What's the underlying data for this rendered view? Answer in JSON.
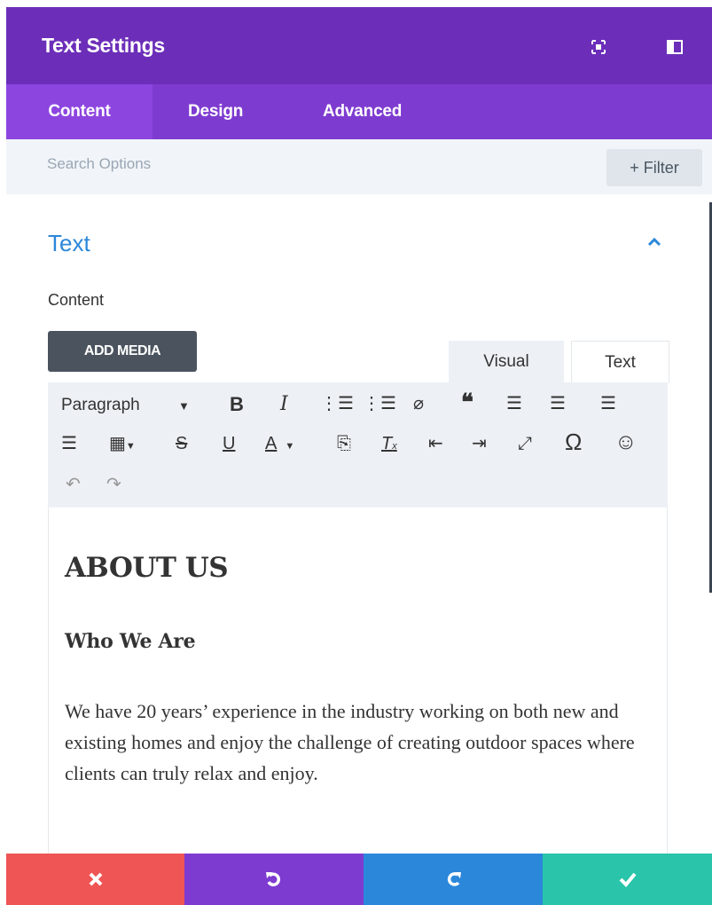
{
  "header": {
    "title": "Text Settings",
    "icons": [
      "expand-icon",
      "split-view-icon"
    ],
    "color": "#6c2eb9"
  },
  "tabs": [
    {
      "label": "Content",
      "active": true
    },
    {
      "label": "Design",
      "active": false
    },
    {
      "label": "Advanced",
      "active": false
    }
  ],
  "search": {
    "placeholder": "Search Options",
    "filter_label": "+ Filter"
  },
  "section": {
    "title": "Text",
    "field_label": "Content",
    "accent": "#2b87da"
  },
  "editor": {
    "add_media": "ADD MEDIA",
    "tab_visual": "Visual",
    "tab_text": "Text",
    "format_select": "Paragraph",
    "toolbar_icons": [
      "bold-icon",
      "italic-icon",
      "bullet-list-icon",
      "numbered-list-icon",
      "link-icon",
      "blockquote-icon",
      "align-left-icon",
      "align-center-icon",
      "align-right-icon",
      "justify-icon",
      "table-icon",
      "strikethrough-icon",
      "underline-icon",
      "text-color-icon",
      "paste-text-icon",
      "clear-formatting-icon",
      "outdent-icon",
      "indent-icon",
      "fullscreen-icon",
      "special-character-icon",
      "emoji-icon",
      "undo-icon",
      "redo-icon"
    ],
    "body": {
      "heading": "ABOUT US",
      "subheading": "Who We Are",
      "paragraph": "We have 20 years’ experience in the industry working on both new and existing homes and enjoy the challenge of creating outdoor spaces where clients can truly relax and enjoy."
    }
  },
  "footer": {
    "buttons": [
      {
        "icon": "close-icon",
        "color": "#ef5555"
      },
      {
        "icon": "undo-icon",
        "color": "#7e3bd0"
      },
      {
        "icon": "redo-icon",
        "color": "#2b87da"
      },
      {
        "icon": "check-icon",
        "color": "#29c4a9"
      }
    ]
  }
}
